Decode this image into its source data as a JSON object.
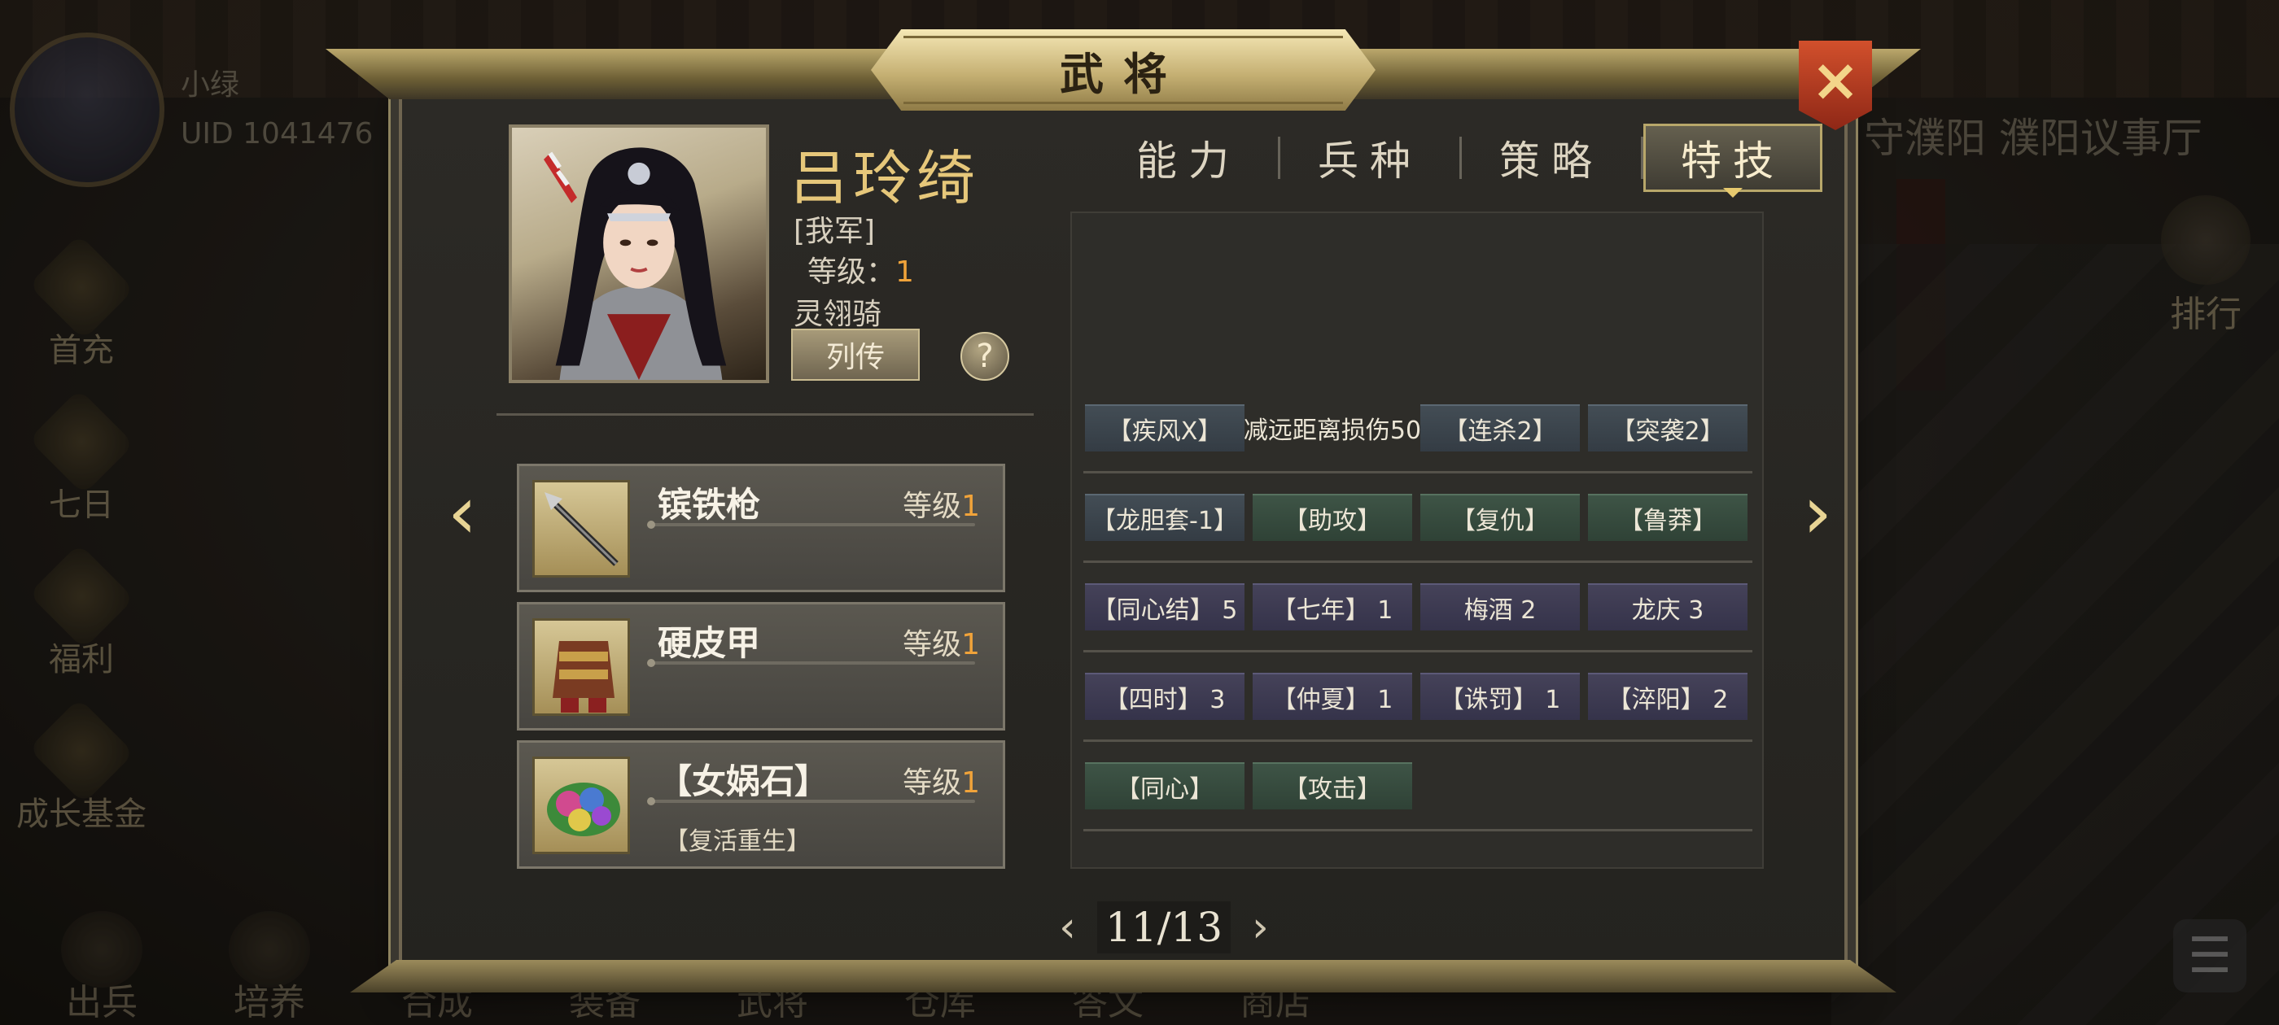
{
  "background": {
    "user_name": "小绿",
    "uid": "UID  1041476",
    "location": "守濮阳 濮阳议事厅",
    "left_menu": [
      "首充",
      "七日",
      "福利",
      "成长基金"
    ],
    "right_menu": [
      "排行"
    ],
    "bottom_menu": [
      "出兵",
      "培养",
      "合成",
      "装备",
      "武将",
      "仓库",
      "答文",
      "商店"
    ]
  },
  "dialog": {
    "title": "武将",
    "close_icon": "×"
  },
  "hero": {
    "name": "吕玲绮",
    "faction": "[我军]",
    "level_label": "等级：",
    "level_value": "1",
    "unit": "灵翎骑",
    "bio_button": "列传",
    "help_button": "?"
  },
  "equipment": [
    {
      "name": "镔铁枪",
      "level_label": "等级",
      "level": "1",
      "sub": "",
      "icon": "spear-icon"
    },
    {
      "name": "硬皮甲",
      "level_label": "等级",
      "level": "1",
      "sub": "",
      "icon": "armor-icon"
    },
    {
      "name": "【女娲石】",
      "level_label": "等级",
      "level": "1",
      "sub": "【复活重生】",
      "icon": "gem-icon"
    }
  ],
  "tabs": [
    {
      "label": "能力",
      "active": false
    },
    {
      "label": "兵种",
      "active": false
    },
    {
      "label": "策略",
      "active": false
    },
    {
      "label": "特技",
      "active": true
    }
  ],
  "skills": [
    [
      {
        "label": "【疾风X】",
        "style": "blue"
      },
      {
        "label": "减远距离损伤50",
        "style": "plain"
      },
      {
        "label": "【连杀2】",
        "style": "blue"
      },
      {
        "label": "【突袭2】",
        "style": "blue"
      }
    ],
    [
      {
        "label": "【龙胆套-1】",
        "style": "blue"
      },
      {
        "label": "【助攻】",
        "style": "green"
      },
      {
        "label": "【复仇】",
        "style": "green"
      },
      {
        "label": "【鲁莽】",
        "style": "green"
      }
    ],
    [
      {
        "label": "【同心结】 5",
        "style": "purple"
      },
      {
        "label": "【七年】 1",
        "style": "purple"
      },
      {
        "label": "梅酒 2",
        "style": "purple"
      },
      {
        "label": "龙庆 3",
        "style": "purple"
      }
    ],
    [
      {
        "label": "【四时】 3",
        "style": "purple"
      },
      {
        "label": "【仲夏】 1",
        "style": "purple"
      },
      {
        "label": "【诛罚】 1",
        "style": "purple"
      },
      {
        "label": "【淬阳】 2",
        "style": "purple"
      }
    ],
    [
      {
        "label": "【同心】",
        "style": "green"
      },
      {
        "label": "【攻击】",
        "style": "green"
      }
    ]
  ],
  "pager": {
    "current_total": "11/13",
    "prev": "‹",
    "next": "›"
  },
  "nav": {
    "left_arrow": "‹",
    "right_arrow": "›"
  }
}
